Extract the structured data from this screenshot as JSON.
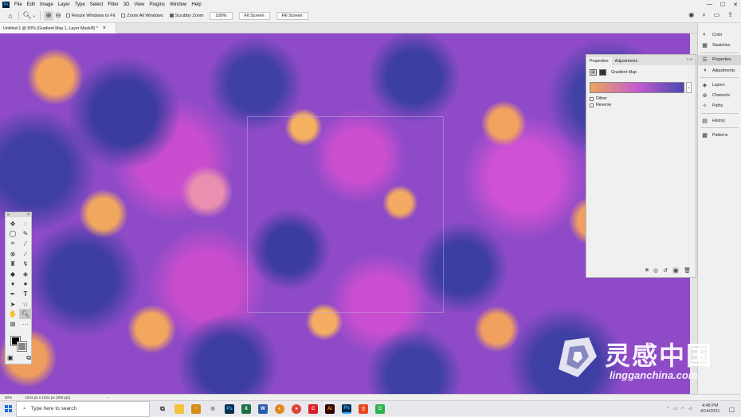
{
  "app": {
    "logo_text": "Ps",
    "menu": [
      "File",
      "Edit",
      "Image",
      "Layer",
      "Type",
      "Select",
      "Filter",
      "3D",
      "View",
      "Plugins",
      "Window",
      "Help"
    ],
    "window_controls": [
      "—",
      "☐",
      "✕"
    ]
  },
  "options_bar": {
    "resize_windows_label": "Resize Windows to Fit",
    "zoom_all_windows_label": "Zoom All Windows",
    "scrubby_zoom_label": "Scrubby Zoom",
    "zoom_value": "100%",
    "fit_screen_label": "Fit Screen",
    "fill_screen_label": "Fill Screen"
  },
  "document": {
    "tab_title": "Untitled-1 @ 50% (Gradient Map 1, Layer Mask/8) *",
    "close": "×"
  },
  "toolbox": {
    "collapse": "»",
    "close": "×",
    "tools": [
      "move-tool",
      "marquee-tool",
      "lasso-tool",
      "quick-select-tool",
      "crop-tool",
      "eyedropper-tool",
      "healing-tool",
      "brush-tool",
      "stamp-tool",
      "history-brush-tool",
      "eraser-tool",
      "gradient-tool",
      "blur-tool",
      "dodge-tool",
      "pen-tool",
      "type-tool",
      "path-select-tool",
      "shape-tool",
      "hand-tool",
      "zoom-tool",
      "frame-tool",
      "more-tool"
    ],
    "foreground_color": "#000000",
    "background_color": "#888888"
  },
  "properties_panel": {
    "tabs": [
      "Properties",
      "Adjustments"
    ],
    "active_tab": "Properties",
    "collapse": "»",
    "menu": "≡",
    "adjustment_name": "Gradient Map",
    "gradient_colors": [
      "#e9a65a",
      "#c65bd0",
      "#4a47b3"
    ],
    "options": [
      {
        "label": "Dither",
        "checked": false
      },
      {
        "label": "Reverse",
        "checked": false
      }
    ]
  },
  "dock": {
    "items": [
      {
        "label": "Color",
        "icon": "color-icon"
      },
      {
        "label": "Swatches",
        "icon": "swatches-icon"
      },
      {
        "label": "Properties",
        "icon": "properties-icon",
        "active": true
      },
      {
        "label": "Adjustments",
        "icon": "adjustments-icon"
      },
      {
        "label": "Layers",
        "icon": "layers-icon"
      },
      {
        "label": "Channels",
        "icon": "channels-icon"
      },
      {
        "label": "Paths",
        "icon": "paths-icon"
      },
      {
        "label": "History",
        "icon": "history-icon"
      },
      {
        "label": "Patterns",
        "icon": "patterns-icon"
      }
    ]
  },
  "status_bar": {
    "zoom": "50%",
    "doc_info": "1024 px x 1024 px (300 ppi)",
    "arrow": "›"
  },
  "taskbar": {
    "search_placeholder": "Type here to search",
    "time": "4:48 PM",
    "date": "4/14/2021"
  },
  "watermark": {
    "title": "灵感中国",
    "subtitle": "lingganchina.com"
  }
}
